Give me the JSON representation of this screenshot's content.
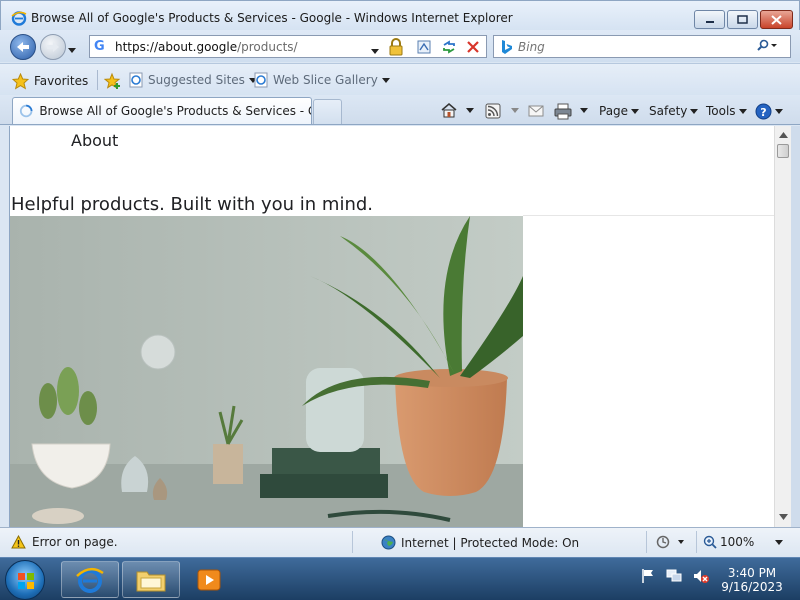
{
  "window": {
    "title": "Browse All of Google's Products & Services - Google - Windows Internet Explorer"
  },
  "address": {
    "url_host": "https://about.google",
    "url_path": "/products/"
  },
  "search": {
    "placeholder": "Bing"
  },
  "favorites_bar": {
    "favorites_label": "Favorites",
    "links": [
      {
        "label": "Suggested Sites"
      },
      {
        "label": "Web Slice Gallery"
      }
    ]
  },
  "tabs": [
    {
      "label": "Browse All of Google's Products & Services - Goo..."
    }
  ],
  "command_bar": {
    "page_label": "Page",
    "safety_label": "Safety",
    "tools_label": "Tools"
  },
  "page": {
    "nav_label": "About",
    "headline": "Helpful products. Built with you in mind."
  },
  "status": {
    "error_text": "Error on page.",
    "zone_text": "Internet | Protected Mode: On",
    "zoom_text": "100%"
  },
  "taskbar": {
    "time": "3:40 PM",
    "date": "9/16/2023"
  },
  "colors": {
    "window_frame": "#dbe6f3",
    "close_button": "#c8432a",
    "taskbar": "#1c3e63"
  }
}
